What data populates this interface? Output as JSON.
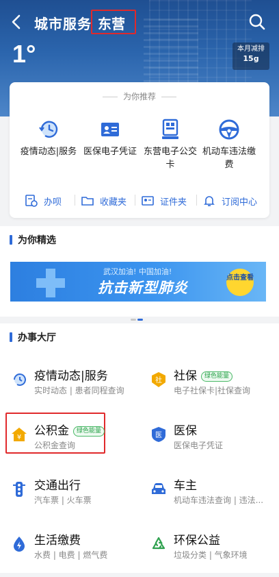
{
  "header": {
    "title": "城市服务",
    "city": "东营",
    "temperature": "1°",
    "traffic_label": "本月减排",
    "traffic_value": "15g"
  },
  "recommend": {
    "title": "为你推荐",
    "items": [
      {
        "label": "疫情动态|服务",
        "icon": "clock-refresh-icon"
      },
      {
        "label": "医保电子凭证",
        "icon": "id-card-icon"
      },
      {
        "label": "东营电子公交卡",
        "icon": "qr-bus-card-icon"
      },
      {
        "label": "机动车违法缴费",
        "icon": "steering-wheel-icon"
      }
    ],
    "quick": [
      {
        "label": "办呗",
        "icon": "doc-clock-icon"
      },
      {
        "label": "收藏夹",
        "icon": "folder-icon"
      },
      {
        "label": "证件夹",
        "icon": "id-folder-icon"
      },
      {
        "label": "订阅中心",
        "icon": "bell-icon"
      }
    ]
  },
  "featured": {
    "title": "为你精选",
    "banner_top": "武汉加油! 中国加油!",
    "banner_main": "抗击新型肺炎",
    "banner_button": "点击查看"
  },
  "hall": {
    "title": "办事大厅",
    "services": [
      {
        "name": "疫情动态|服务",
        "desc": "实时动态 | 患者同程查询",
        "badge": "",
        "icon": "clock-refresh-icon"
      },
      {
        "name": "社保",
        "desc": "电子社保卡|社保查询",
        "badge": "绿色能量",
        "icon": "social-security-icon"
      },
      {
        "name": "公积金",
        "desc": "公积金查询",
        "badge": "绿色能量",
        "icon": "housing-fund-icon"
      },
      {
        "name": "医保",
        "desc": "医保电子凭证",
        "badge": "",
        "icon": "medical-insurance-icon"
      },
      {
        "name": "交通出行",
        "desc": "汽车票 | 火车票",
        "badge": "",
        "icon": "traffic-light-icon"
      },
      {
        "name": "车主",
        "desc": "机动车违法查询 | 违法...",
        "badge": "",
        "icon": "car-icon"
      },
      {
        "name": "生活缴费",
        "desc": "水费 | 电费 | 燃气费",
        "badge": "",
        "icon": "lightning-icon"
      },
      {
        "name": "环保公益",
        "desc": "垃圾分类 | 气象环境",
        "badge": "",
        "icon": "recycle-icon"
      }
    ]
  },
  "colors": {
    "primary": "#2f6bd8",
    "highlight": "#e0292b",
    "badge_green": "#2aa34a"
  }
}
